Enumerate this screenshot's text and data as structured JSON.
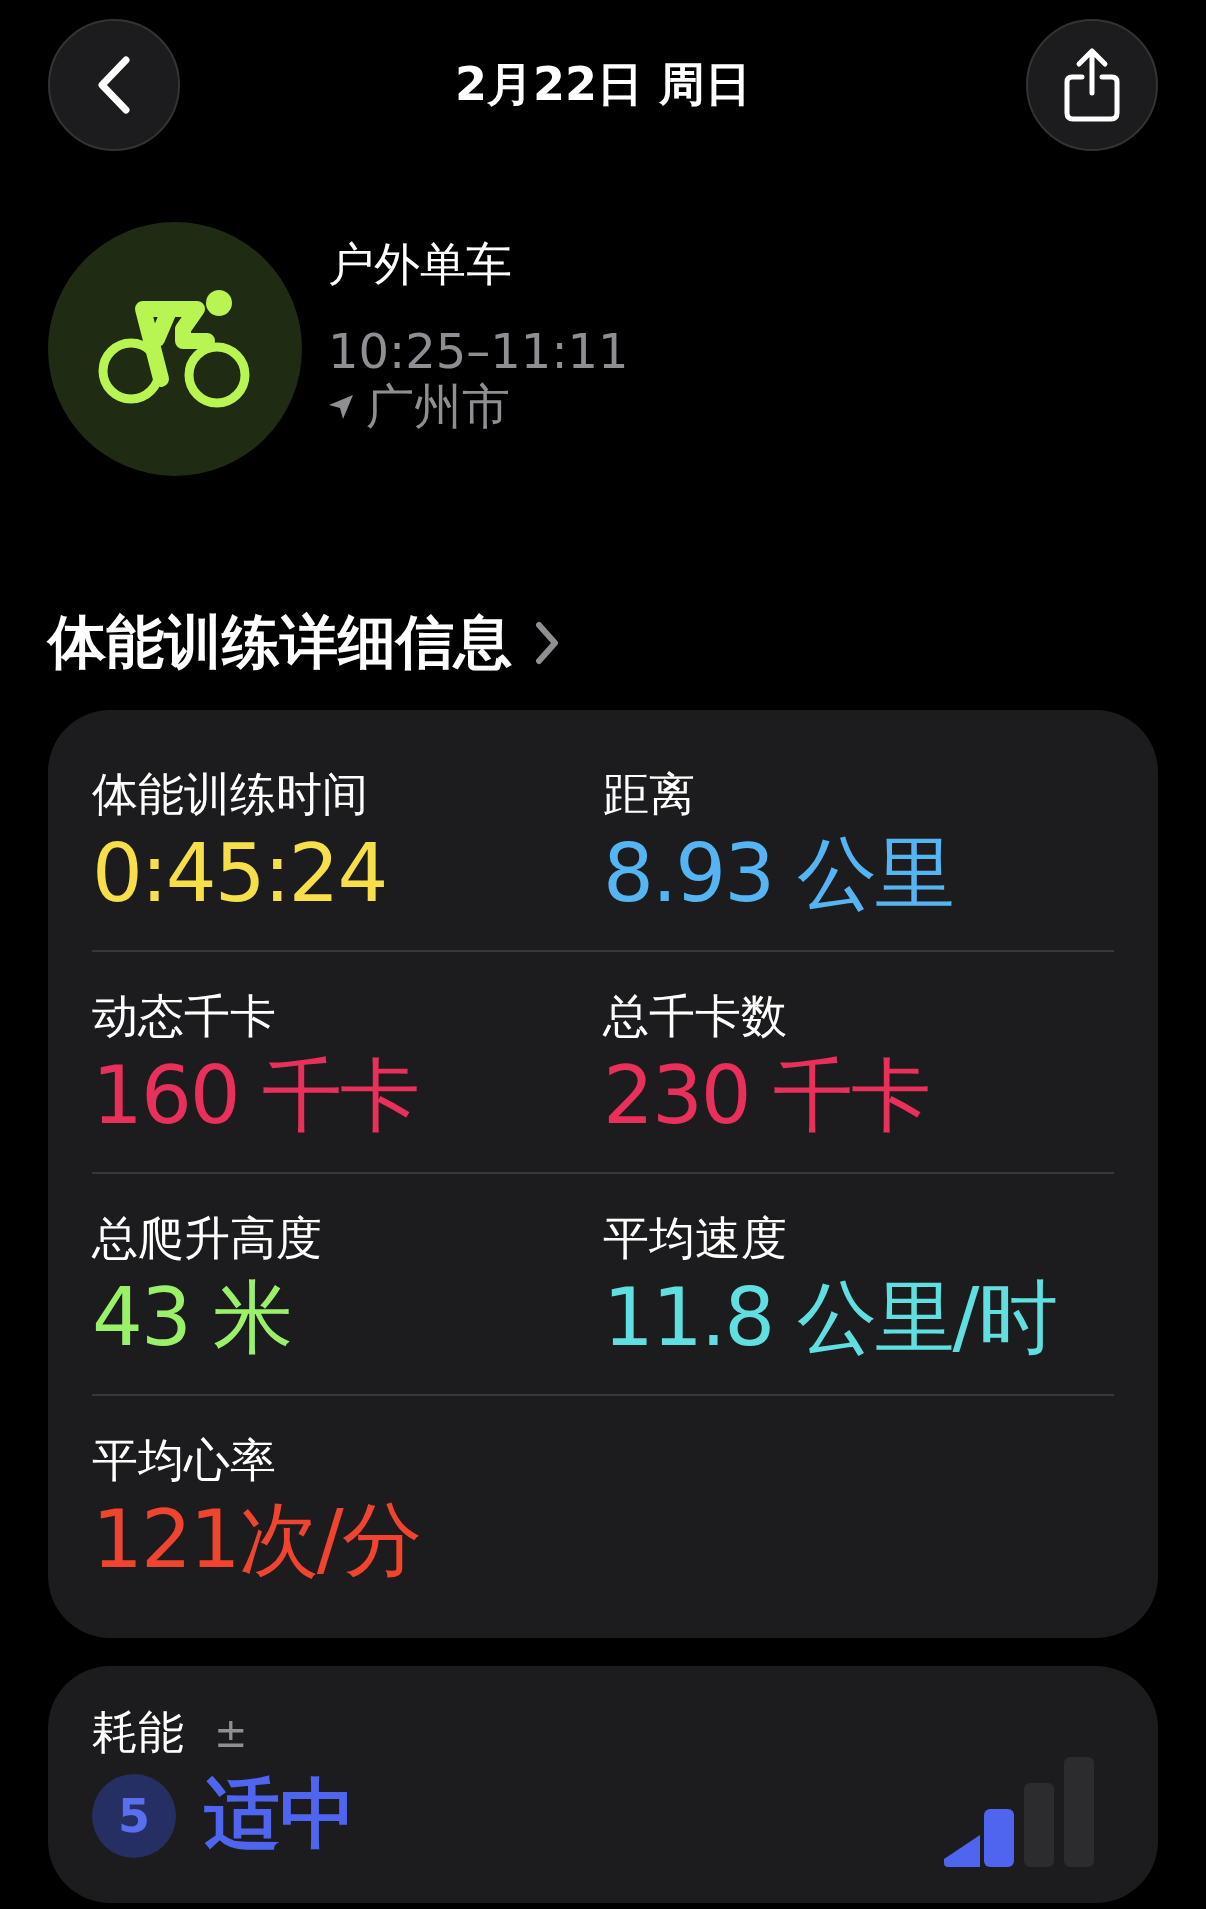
{
  "header": {
    "title": "2月22日 周日"
  },
  "workout": {
    "name": "户外单车",
    "time": "10:25–11:11",
    "location": "广州市"
  },
  "section": {
    "title": "体能训练详细信息"
  },
  "metrics": [
    {
      "label": "体能训练时间",
      "value": "0:45:24",
      "color": "#f7df4a"
    },
    {
      "label": "距离",
      "value": "8.93 公里",
      "color": "#55b4f2"
    },
    {
      "label": "动态千卡",
      "value": "160 千卡",
      "color": "#e8305a"
    },
    {
      "label": "总千卡数",
      "value": "230 千卡",
      "color": "#e8305a"
    },
    {
      "label": "总爬升高度",
      "value": "43 米",
      "color": "#9bf06a"
    },
    {
      "label": "平均速度",
      "value": "11.8 公里/时",
      "color": "#5fdfe0"
    },
    {
      "label": "平均心率",
      "value": "121次/分",
      "color": "#f0442e"
    }
  ],
  "effort": {
    "label": "耗能",
    "adjust": "±",
    "score": "5",
    "rating": "适中"
  }
}
